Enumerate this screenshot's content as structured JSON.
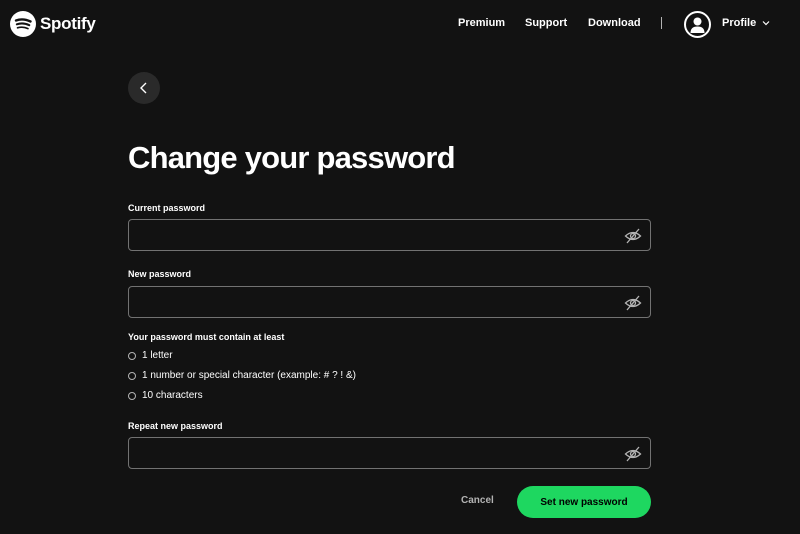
{
  "header": {
    "brand": "Spotify",
    "nav": [
      "Premium",
      "Support",
      "Download"
    ],
    "profile_label": "Profile"
  },
  "page": {
    "title": "Change your password"
  },
  "form": {
    "current_password": {
      "label": "Current password",
      "value": ""
    },
    "new_password": {
      "label": "New password",
      "value": ""
    },
    "requirements_title": "Your password must contain at least",
    "requirements": [
      "1 letter",
      "1 number or special character (example: # ? ! &)",
      "10 characters"
    ],
    "repeat_password": {
      "label": "Repeat new password",
      "value": ""
    },
    "cancel_label": "Cancel",
    "submit_label": "Set new password"
  },
  "colors": {
    "accent": "#1ed760",
    "background": "#121212",
    "field_border": "#727272"
  }
}
